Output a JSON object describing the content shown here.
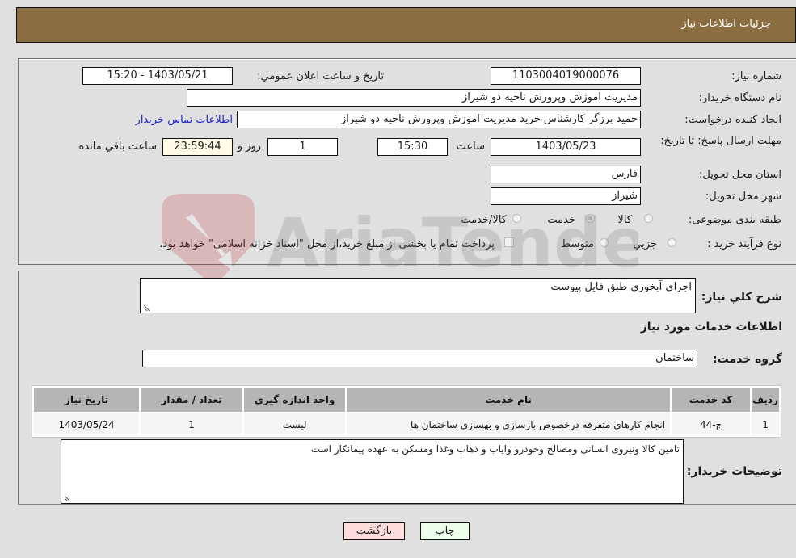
{
  "header": {
    "title": "جزئيات اطلاعات نياز"
  },
  "fields": {
    "need_number": {
      "label": "شماره نياز:",
      "value": "1103004019000076"
    },
    "announce_datetime": {
      "label": "تاريخ و ساعت اعلان عمومي:",
      "value": "1403/05/21 - 15:20"
    },
    "buyer_org": {
      "label": "نام دستگاه خريدار:",
      "value": "مديريت اموزش وپرورش ناحيه دو شيراز"
    },
    "requester": {
      "label": "ايجاد کننده درخواست:",
      "value": "حميد برزگر کارشناس خريد مديريت اموزش وپرورش ناحيه دو شيراز"
    },
    "buyer_contact_link": "اطلاعات تماس خريدار",
    "deadline": {
      "label": "مهلت ارسال پاسخ: تا تاريخ:",
      "date": "1403/05/23",
      "time_label": "ساعت",
      "time": "15:30",
      "days": "1",
      "days_label": "روز و",
      "remaining": "23:59:44",
      "remaining_label": "ساعت باقي مانده"
    },
    "province": {
      "label": "استان محل تحويل:",
      "value": "فارس"
    },
    "city": {
      "label": "شهر محل تحويل:",
      "value": "شيراز"
    },
    "category": {
      "label": "طبقه بندی موضوعی:",
      "options": [
        "کالا",
        "خدمت",
        "کالا/خدمت"
      ],
      "selected": "خدمت"
    },
    "purchase_process": {
      "label": "نوع فرآيند خريد :",
      "options": [
        "جزيي",
        "متوسط"
      ],
      "treasury_note": "پرداخت تمام يا بخشی از مبلغ خريد،از محل \"اسناد خزانه اسلامی\" خواهد بود."
    }
  },
  "details": {
    "general_desc_label": "شرح کلي نياز:",
    "general_desc": "اجرای آبخوری طبق فایل پیوست",
    "services_title": "اطلاعات خدمات مورد نياز",
    "service_group_label": "گروه خدمت:",
    "service_group": "ساختمان",
    "table": {
      "headers": [
        "رديف",
        "کد خدمت",
        "نام خدمت",
        "واحد اندازه گيری",
        "تعداد / مقدار",
        "تاريخ نياز"
      ],
      "rows": [
        [
          "1",
          "ج-44",
          "انجام کارهای متفرقه درخصوص بازسازی و بهسازی ساختمان ها",
          "ليست",
          "1",
          "1403/05/24"
        ]
      ]
    },
    "buyer_notes_label": "توضيحات خريدار:",
    "buyer_notes": "تامين کالا ونيروی انسانی ومصالح وخودرو واياب و ذهاب وغذا ومسکن به عهده پيمانکار است"
  },
  "buttons": {
    "print": "چاپ",
    "back": "بازگشت"
  },
  "colors": {
    "header_bg": "#8b6d42",
    "print_bg": "#eeffee",
    "back_bg": "#ffdddd",
    "link": "#2222cc"
  }
}
